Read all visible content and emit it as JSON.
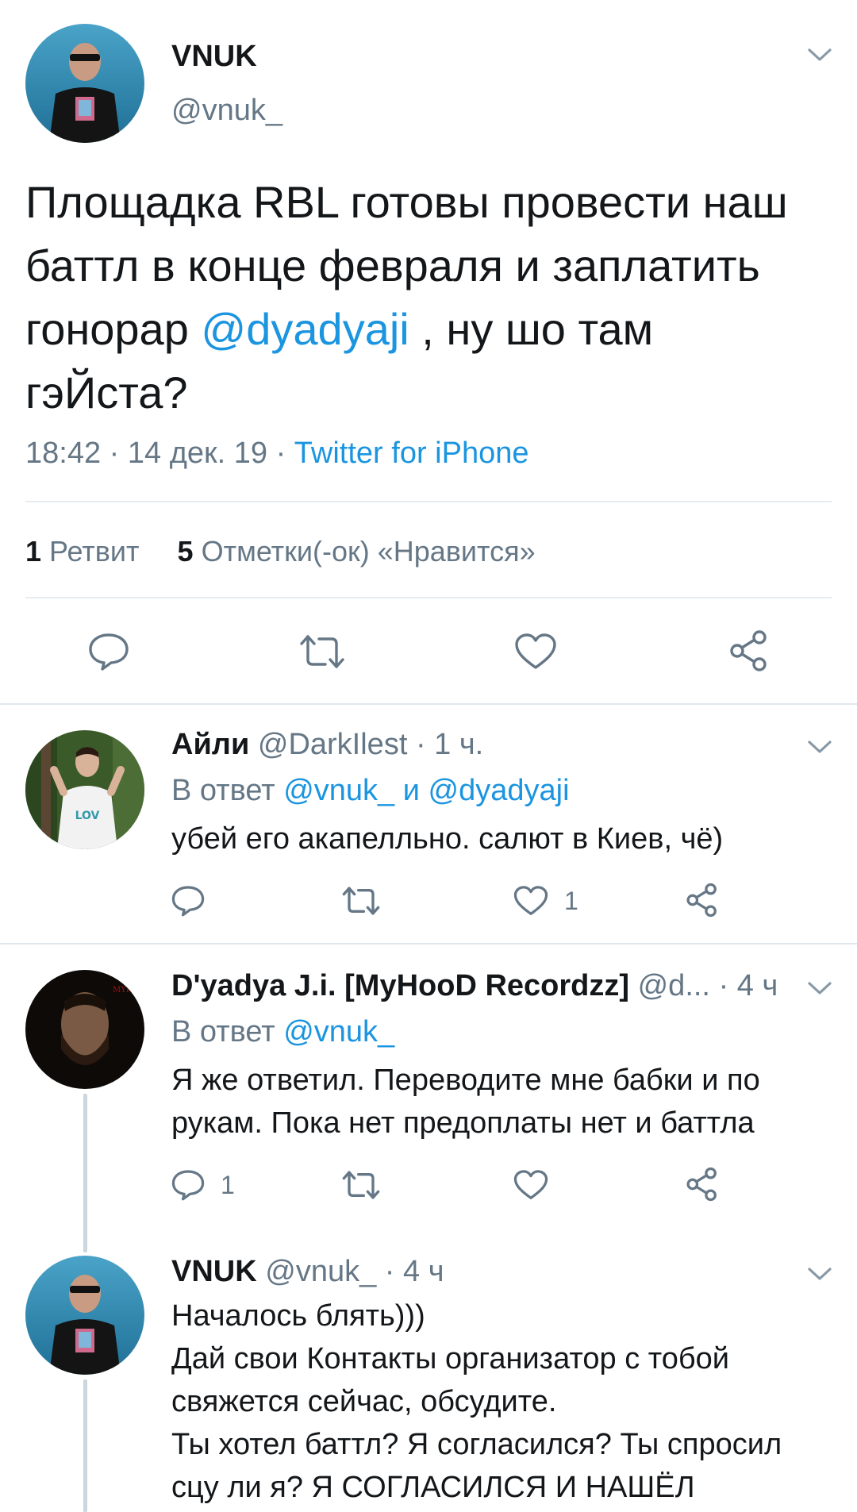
{
  "main_tweet": {
    "display_name": "VNUK",
    "handle": "@vnuk_",
    "text_before": "Площадка RBL готовы провести наш баттл в конце февраля и заплатить гонорар ",
    "mention": "@dyadyaji",
    "text_after": " , ну шо там гэЙста?",
    "time": "18:42",
    "date": "14 дек. 19",
    "sep": "·",
    "source": "Twitter for iPhone",
    "retweets_count": "1",
    "retweets_label": "Ретвит",
    "likes_count": "5",
    "likes_label": "Отметки(-ок) «Нравится»"
  },
  "replies": [
    {
      "display_name": "Айли",
      "handle": "@DarkIlest",
      "time": "· 1 ч.",
      "reply_prefix": "В ответ ",
      "reply_to": "@vnuk_ и @dyadyaji",
      "lines": [
        "убей его акапелльно. салют в Киев, чё)"
      ],
      "reply_count": "",
      "like_count": "1"
    },
    {
      "display_name": "D'yadya J.i. [MyHooD Recordzz]",
      "handle": "@d...",
      "time": "· 4 ч",
      "reply_prefix": "В ответ ",
      "reply_to": "@vnuk_",
      "lines": [
        "Я же ответил. Переводите мне бабки и по",
        "рукам. Пока нет предоплаты нет и баттла"
      ],
      "reply_count": "1",
      "like_count": ""
    },
    {
      "display_name": "VNUK",
      "handle": "@vnuk_",
      "time": "· 4 ч",
      "lines": [
        "Началось блять)))",
        "Дай свои Контакты организатор с тобой",
        "свяжется сейчас, обсудите.",
        "Ты хотел баттл? Я согласился? Ты спросил",
        "сцу ли я? Я СОГЛАСИЛСЯ И НАШЁЛ"
      ]
    }
  ],
  "icons": {
    "reply": "reply-icon",
    "retweet": "retweet-icon",
    "like": "heart-icon",
    "share": "share-icon",
    "menu": "chevron-down-icon"
  },
  "colors": {
    "link": "#1b95e0",
    "secondary": "#657786",
    "divider": "#e6ecf0"
  }
}
